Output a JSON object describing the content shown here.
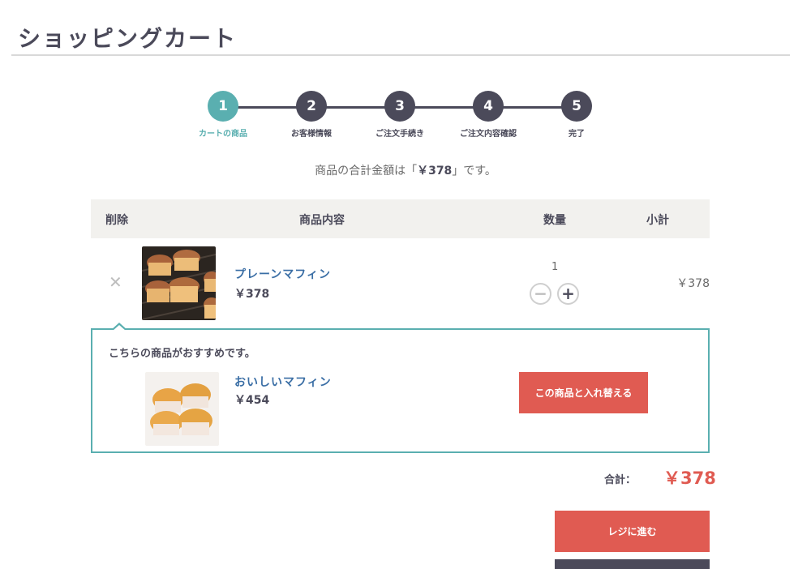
{
  "page": {
    "title": "ショッピングカート"
  },
  "steps": [
    {
      "num": "1",
      "label": "カートの商品",
      "active": true
    },
    {
      "num": "2",
      "label": "お客様情報"
    },
    {
      "num": "3",
      "label": "ご注文手続き"
    },
    {
      "num": "4",
      "label": "ご注文内容確認"
    },
    {
      "num": "5",
      "label": "完了"
    }
  ],
  "summary": {
    "prefix": "商品の合計金額は「",
    "amount": "￥378",
    "suffix": "」です。"
  },
  "table": {
    "headers": {
      "remove": "削除",
      "item": "商品内容",
      "qty": "数量",
      "subtotal": "小計"
    },
    "items": [
      {
        "name": "プレーンマフィン",
        "price": "￥378",
        "qty": "1",
        "subtotal": "￥378",
        "remove_icon": "close-icon"
      }
    ]
  },
  "recommend": {
    "heading": "こちらの商品がおすすめです。",
    "name": "おいしいマフィン",
    "price": "￥454",
    "button": "この商品と入れ替える"
  },
  "total": {
    "label": "合計：",
    "value": "￥378"
  },
  "actions": {
    "checkout": "レジに進む"
  },
  "colors": {
    "accent": "#5aafb0",
    "cta": "#e05b52",
    "dark": "#4b4a5a",
    "link": "#3a6ea5"
  }
}
